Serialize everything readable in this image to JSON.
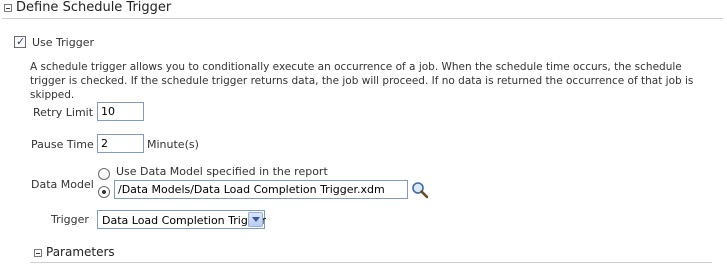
{
  "section": {
    "title": "Define Schedule Trigger"
  },
  "use_trigger": {
    "label": "Use Trigger",
    "checked": true
  },
  "description": "A schedule trigger allows you to conditionally execute an occurrence of a job. When the schedule time occurs, the schedule trigger is checked. If the schedule trigger returns data, the job will proceed. If no data is returned the occurrence of that job is skipped.",
  "retry_limit": {
    "label": "Retry Limit",
    "value": "10"
  },
  "pause_time": {
    "label": "Pause Time",
    "value": "2",
    "unit": "Minute(s)"
  },
  "data_model": {
    "label": "Data Model",
    "option_report": "Use Data Model specified in the report",
    "path_value": "/Data Models/Data Load Completion Trigger.xdm",
    "selected": "path",
    "browse_icon": "search-icon"
  },
  "trigger": {
    "label": "Trigger",
    "selected": "Data Load Completion Trigger"
  },
  "parameters": {
    "title": "Parameters"
  }
}
